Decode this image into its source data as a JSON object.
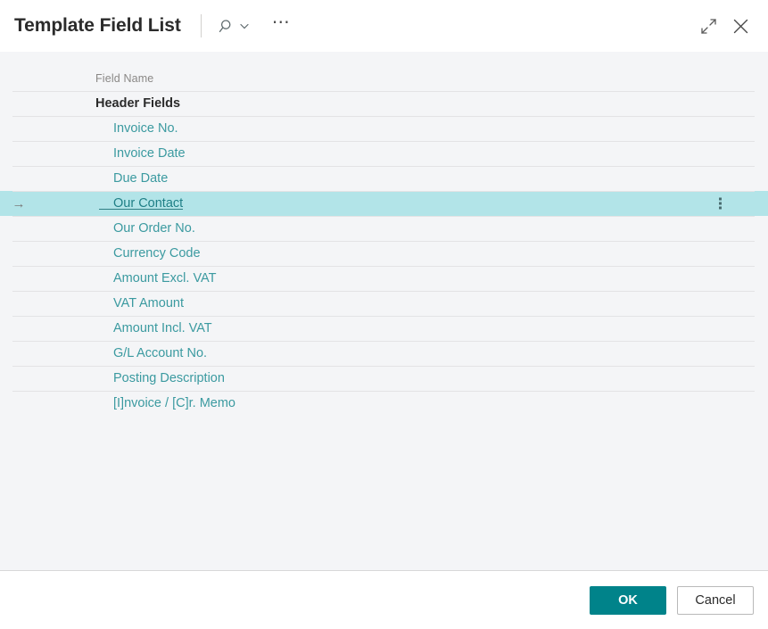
{
  "window": {
    "title": "Template Field List",
    "search_icon": "search-icon",
    "search_chevron_icon": "chevron-down-icon",
    "more_icon": "ellipsis-horizontal-icon",
    "expand_icon": "expand-diagonal-icon",
    "close_icon": "close-x-icon"
  },
  "grid": {
    "columns": [
      {
        "key": "field_name",
        "label": "Field Name"
      }
    ],
    "selected_row_index": 3,
    "row_menu_icon": "more-vertical-icon",
    "row_indicator_icon": "arrow-right-icon",
    "rows": [
      {
        "label": "Header Fields",
        "type": "group"
      },
      {
        "label": "Invoice No.",
        "type": "item"
      },
      {
        "label": "Invoice Date",
        "type": "item"
      },
      {
        "label": "Due Date",
        "type": "item"
      },
      {
        "label": "Our Contact",
        "type": "item",
        "selected": true
      },
      {
        "label": "Our Order No.",
        "type": "item"
      },
      {
        "label": "Currency Code",
        "type": "item"
      },
      {
        "label": "Amount Excl. VAT",
        "type": "item"
      },
      {
        "label": "VAT Amount",
        "type": "item"
      },
      {
        "label": "Amount Incl. VAT",
        "type": "item"
      },
      {
        "label": "G/L Account No.",
        "type": "item"
      },
      {
        "label": "Posting Description",
        "type": "item"
      },
      {
        "label": "[I]nvoice / [C]r. Memo",
        "type": "item"
      }
    ]
  },
  "footer": {
    "ok_label": "OK",
    "cancel_label": "Cancel"
  },
  "colors": {
    "accent_teal": "#00838a",
    "link_teal": "#3b9aa0",
    "selection_teal": "#b2e4e8",
    "panel_gray": "#f4f5f7",
    "rule_gray": "#e3e3e5"
  }
}
